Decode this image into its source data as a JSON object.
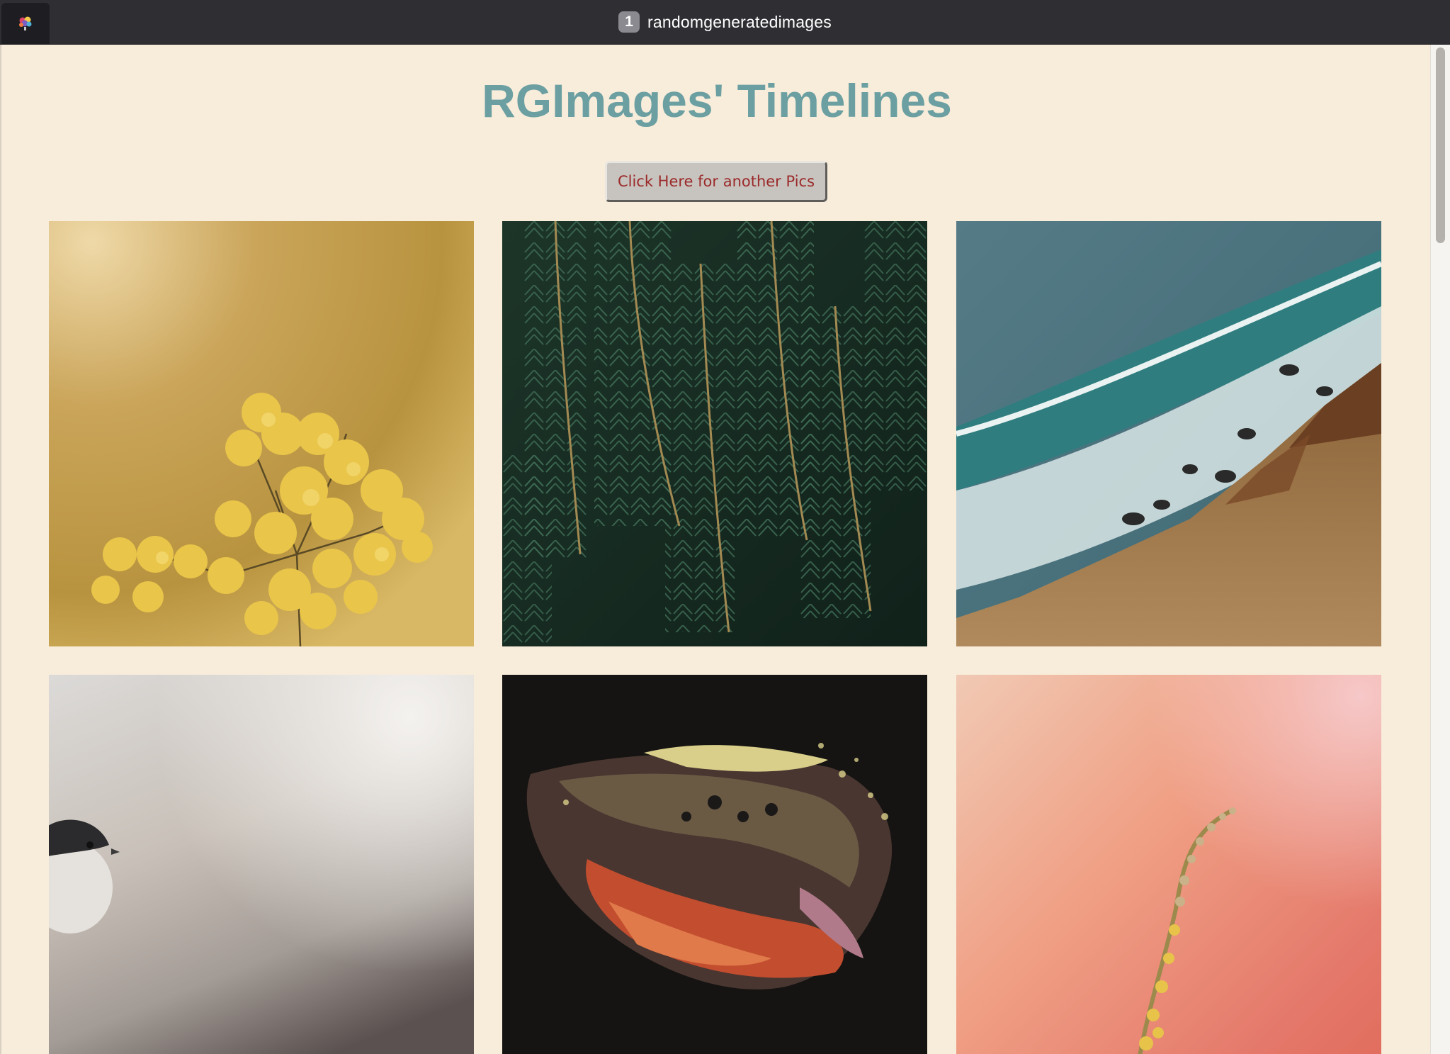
{
  "window": {
    "title": "randomgeneratedimages",
    "tab_count": "1"
  },
  "page": {
    "heading": "RGImages' Timelines",
    "button_label": "Click Here for another Pics"
  },
  "colors": {
    "background": "#f8ecda",
    "heading": "#6b9fa1",
    "button_text": "#9b2a2a",
    "button_face": "#c7c3be"
  },
  "photos": [
    "yellow-mimosa-flowers",
    "green-spruce-branches",
    "ocean-waves-coastline",
    "small-bird-on-branch",
    "abstract-fluid-art",
    "yellow-flower-stem-on-pink"
  ]
}
